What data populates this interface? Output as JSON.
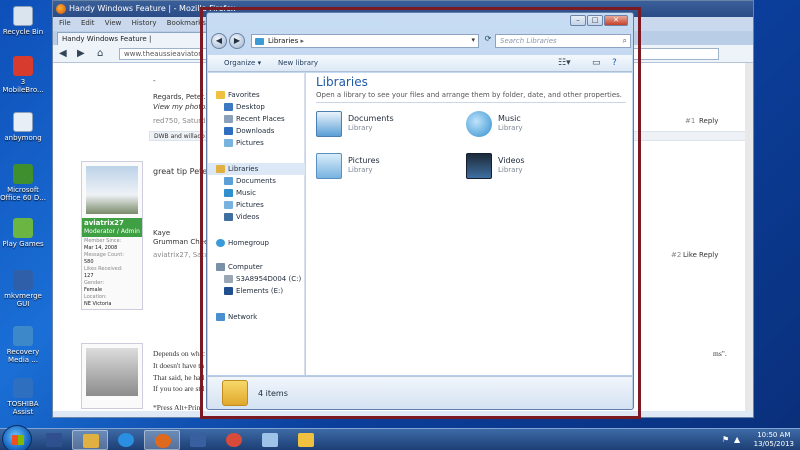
{
  "desktop_icons": [
    {
      "label": "Recycle Bin",
      "color": "#d9e4ef"
    },
    {
      "label": "3 MobileBro...",
      "color": "#d63b2e"
    },
    {
      "label": "anbymong",
      "color": "#e8eef6"
    },
    {
      "label": "Microsoft Office 60 D...",
      "color": "#3f8f2f"
    },
    {
      "label": "Play Games",
      "color": "#6bb643"
    },
    {
      "label": "mkvmerge GUI",
      "color": "#2f5fa8"
    },
    {
      "label": "Recovery Media ...",
      "color": "#3c88c8"
    },
    {
      "label": "TOSHIBA Assist",
      "color": "#2f6fbf"
    }
  ],
  "firefox": {
    "title": "Handy Windows Feature | - Mozilla Firefox",
    "menu": [
      "File",
      "Edit",
      "View",
      "History",
      "Bookmarks"
    ],
    "tab_label": "Handy Windows Feature |",
    "url": "www.theaussieaviator",
    "post1": {
      "dash": "-",
      "regards": "Regards, Peter.",
      "link": "View my photos at",
      "byline": "red750, Saturday",
      "num": "#1",
      "reply": "Reply",
      "tag": "DWB and willado"
    },
    "post2": {
      "quote": "great tip Peter,",
      "author_name": "aviatrix27",
      "author_role": "Moderator / Admin",
      "meta": [
        {
          "k": "Member Since:",
          "v": "Mar 14, 2008"
        },
        {
          "k": "Message Count:",
          "v": "580"
        },
        {
          "k": "Likes Received:",
          "v": "127"
        },
        {
          "k": "Gender:",
          "v": "Female"
        },
        {
          "k": "Location:",
          "v": "NE Victoria"
        }
      ],
      "sig1": "Kaye",
      "sig2": "Grumman Cheetah",
      "byline": "aviatrix27, Saturd",
      "num": "#2",
      "like": "Like",
      "reply": "Reply"
    },
    "post3": {
      "lines": [
        "Depends on whic",
        "It doesn't have th",
        "That said, he had",
        "If you too are stil",
        "*Press Alt+Print"
      ],
      "trail": "ms\"."
    }
  },
  "explorer": {
    "window_controls": [
      "–",
      "□",
      "✕"
    ],
    "breadcrumb": "Libraries",
    "search_placeholder": "Search Libraries",
    "toolbar": {
      "organize": "Organize ▾",
      "new_library": "New library"
    },
    "nav": {
      "favorites": "Favorites",
      "favorites_items": [
        "Desktop",
        "Recent Places",
        "Downloads",
        "Pictures"
      ],
      "libraries": "Libraries",
      "libraries_items": [
        "Documents",
        "Music",
        "Pictures",
        "Videos"
      ],
      "homegroup": "Homegroup",
      "computer": "Computer",
      "computer_items": [
        "S3A8954D004 (C:)",
        "Elements (E:)"
      ],
      "network": "Network"
    },
    "main": {
      "heading": "Libraries",
      "description": "Open a library to see your files and arrange them by folder, date, and other properties.",
      "libraries": [
        {
          "name": "Documents",
          "type": "Library",
          "color": "#5a9fd6"
        },
        {
          "name": "Music",
          "type": "Library",
          "color": "#2f8fcf"
        },
        {
          "name": "Pictures",
          "type": "Library",
          "color": "#78b3e0"
        },
        {
          "name": "Videos",
          "type": "Library",
          "color": "#3e6f9f"
        }
      ]
    },
    "details": {
      "count": "4 items"
    }
  },
  "taskbar": {
    "time": "10:50 AM",
    "date": "13/05/2013",
    "accent": "#1d3f75"
  }
}
